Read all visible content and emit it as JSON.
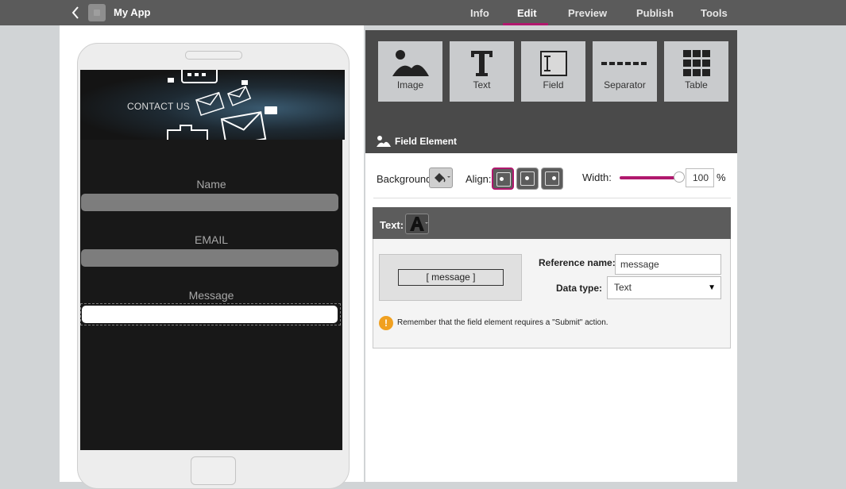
{
  "header": {
    "app_title": "My App",
    "tabs": [
      {
        "label": "Info"
      },
      {
        "label": "Edit"
      },
      {
        "label": "Preview"
      },
      {
        "label": "Publish"
      },
      {
        "label": "Tools"
      }
    ],
    "active_tab": "Edit",
    "accent_color": "#b0186d"
  },
  "phone_preview": {
    "banner_text": "CONTACT US",
    "fields": [
      {
        "label": "Name"
      },
      {
        "label": "EMAIL"
      },
      {
        "label": "Message"
      }
    ]
  },
  "toolbar": {
    "tools": [
      {
        "label": "Image",
        "icon": "image-icon"
      },
      {
        "label": "Text",
        "icon": "text-icon"
      },
      {
        "label": "Field",
        "icon": "field-icon"
      },
      {
        "label": "Separator",
        "icon": "separator-icon"
      },
      {
        "label": "Table",
        "icon": "table-icon"
      }
    ],
    "section_title": "Field Element"
  },
  "properties": {
    "background_label": "Background:",
    "align_label": "Align:",
    "width_label": "Width:",
    "width_value": "100",
    "width_unit": "%",
    "width_percent": 100
  },
  "text_section": {
    "label": "Text:",
    "preview_text": "[ message ]",
    "reference_label": "Reference name:",
    "reference_value": "message",
    "datatype_label": "Data type:",
    "datatype_value": "Text",
    "warning": "Remember that the field element requires a \"Submit\" action."
  }
}
